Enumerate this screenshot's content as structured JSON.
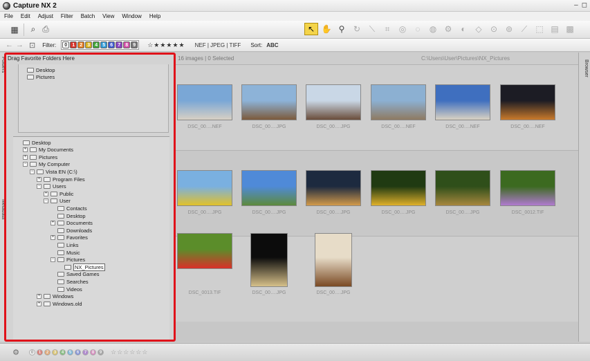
{
  "window": {
    "title": "Capture NX 2",
    "controls": [
      "–",
      "◻"
    ]
  },
  "menu": [
    "File",
    "Edit",
    "Adjust",
    "Filter",
    "Batch",
    "View",
    "Window",
    "Help"
  ],
  "filterbar": {
    "filter_label": "Filter:",
    "labels": [
      {
        "n": "0",
        "color": "#ffffff",
        "text": "#333"
      },
      {
        "n": "1",
        "color": "#d7332a"
      },
      {
        "n": "2",
        "color": "#e67c21"
      },
      {
        "n": "3",
        "color": "#d9b21d"
      },
      {
        "n": "4",
        "color": "#43a63a"
      },
      {
        "n": "5",
        "color": "#2f9ad6"
      },
      {
        "n": "6",
        "color": "#3f5bd1"
      },
      {
        "n": "7",
        "color": "#8b46c2"
      },
      {
        "n": "8",
        "color": "#d24fa7"
      },
      {
        "n": "9",
        "color": "#777777"
      }
    ],
    "rating": "☆★★★★★",
    "formats": "NEF | JPEG | TIFF",
    "sort_label": "Sort:",
    "sort_value": "ABC"
  },
  "side_tabs": {
    "folders": "Folders",
    "metadata": "Metadata",
    "browser": "Browser"
  },
  "favorites": {
    "header": "Drag Favorite Folders Here",
    "items": [
      "Desktop",
      "Pictures"
    ]
  },
  "tree": [
    {
      "label": "Desktop",
      "depth": 0,
      "exp": ""
    },
    {
      "label": "My Documents",
      "depth": 1,
      "exp": "+"
    },
    {
      "label": "Pictures",
      "depth": 1,
      "exp": "+"
    },
    {
      "label": "My Computer",
      "depth": 1,
      "exp": "−"
    },
    {
      "label": "Vista EN (C:\\)",
      "depth": 2,
      "exp": "−"
    },
    {
      "label": "Program Files",
      "depth": 3,
      "exp": "+"
    },
    {
      "label": "Users",
      "depth": 3,
      "exp": "−"
    },
    {
      "label": "Public",
      "depth": 4,
      "exp": "+"
    },
    {
      "label": "User",
      "depth": 4,
      "exp": "−"
    },
    {
      "label": "Contacts",
      "depth": 5,
      "exp": ""
    },
    {
      "label": "Desktop",
      "depth": 5,
      "exp": ""
    },
    {
      "label": "Documents",
      "depth": 5,
      "exp": "+"
    },
    {
      "label": "Downloads",
      "depth": 5,
      "exp": ""
    },
    {
      "label": "Favorites",
      "depth": 5,
      "exp": "+"
    },
    {
      "label": "Links",
      "depth": 5,
      "exp": ""
    },
    {
      "label": "Music",
      "depth": 5,
      "exp": ""
    },
    {
      "label": "Pictures",
      "depth": 5,
      "exp": "−"
    },
    {
      "label": "NX_Pictures",
      "depth": 6,
      "exp": "",
      "selected": true
    },
    {
      "label": "Saved Games",
      "depth": 5,
      "exp": ""
    },
    {
      "label": "Searches",
      "depth": 5,
      "exp": ""
    },
    {
      "label": "Videos",
      "depth": 5,
      "exp": ""
    },
    {
      "label": "Windows",
      "depth": 3,
      "exp": "+"
    },
    {
      "label": "Windows.old",
      "depth": 3,
      "exp": "+"
    }
  ],
  "browser": {
    "count": "16 images | 0 Selected",
    "path": "C:\\Users\\User\\Pictures\\NX_Pictures",
    "thumbs": [
      {
        "cap": "DSC_00….NEF",
        "c1": "#7aa7d6",
        "c2": "#d8d0c4"
      },
      {
        "cap": "DSC_00….JPG",
        "c1": "#8db3d8",
        "c2": "#7c5a3b"
      },
      {
        "cap": "DSC_00….JPG",
        "c1": "#c9d7e6",
        "c2": "#6a4d3a"
      },
      {
        "cap": "DSC_00….NEF",
        "c1": "#8cb0d2",
        "c2": "#8e7a62"
      },
      {
        "cap": "DSC_00….NEF",
        "c1": "#3f6fbf",
        "c2": "#d9d2c2"
      },
      {
        "cap": "DSC_00….NEF",
        "c1": "#1c1c24",
        "c2": "#c97a2b"
      },
      {
        "cap": "DSC_00….JPG",
        "c1": "#7ab0e0",
        "c2": "#e2c12a"
      },
      {
        "cap": "DSC_00….JPG",
        "c1": "#4f8ad8",
        "c2": "#5d8a3c"
      },
      {
        "cap": "DSC_00….JPG",
        "c1": "#1d2a3f",
        "c2": "#d39a4a"
      },
      {
        "cap": "DSC_00….JPG",
        "c1": "#203a12",
        "c2": "#e0b02a"
      },
      {
        "cap": "DSC_00….JPG",
        "c1": "#2f4f1a",
        "c2": "#a7873e"
      },
      {
        "cap": "DSC_0012.TIF",
        "c1": "#3c6a20",
        "c2": "#b07ad0"
      },
      {
        "cap": "DSC_0013.TIF",
        "c1": "#5b8d2a",
        "c2": "#d9302a"
      },
      {
        "cap": "DSC_00….JPG",
        "c1": "#0c0c0c",
        "c2": "#d6c08a"
      },
      {
        "cap": "DSC_00….JPG",
        "c1": "#e7dcc8",
        "c2": "#7a4a24"
      }
    ]
  },
  "bottom": {
    "labels": [
      {
        "n": "0",
        "color": "#ffffff"
      },
      {
        "n": "1",
        "color": "#d7332a"
      },
      {
        "n": "2",
        "color": "#e67c21"
      },
      {
        "n": "3",
        "color": "#d9b21d"
      },
      {
        "n": "4",
        "color": "#43a63a"
      },
      {
        "n": "5",
        "color": "#2f9ad6"
      },
      {
        "n": "6",
        "color": "#3f5bd1"
      },
      {
        "n": "7",
        "color": "#8b46c2"
      },
      {
        "n": "8",
        "color": "#d24fa7"
      },
      {
        "n": "9",
        "color": "#777777"
      }
    ],
    "rating": "☆☆☆☆☆☆"
  }
}
